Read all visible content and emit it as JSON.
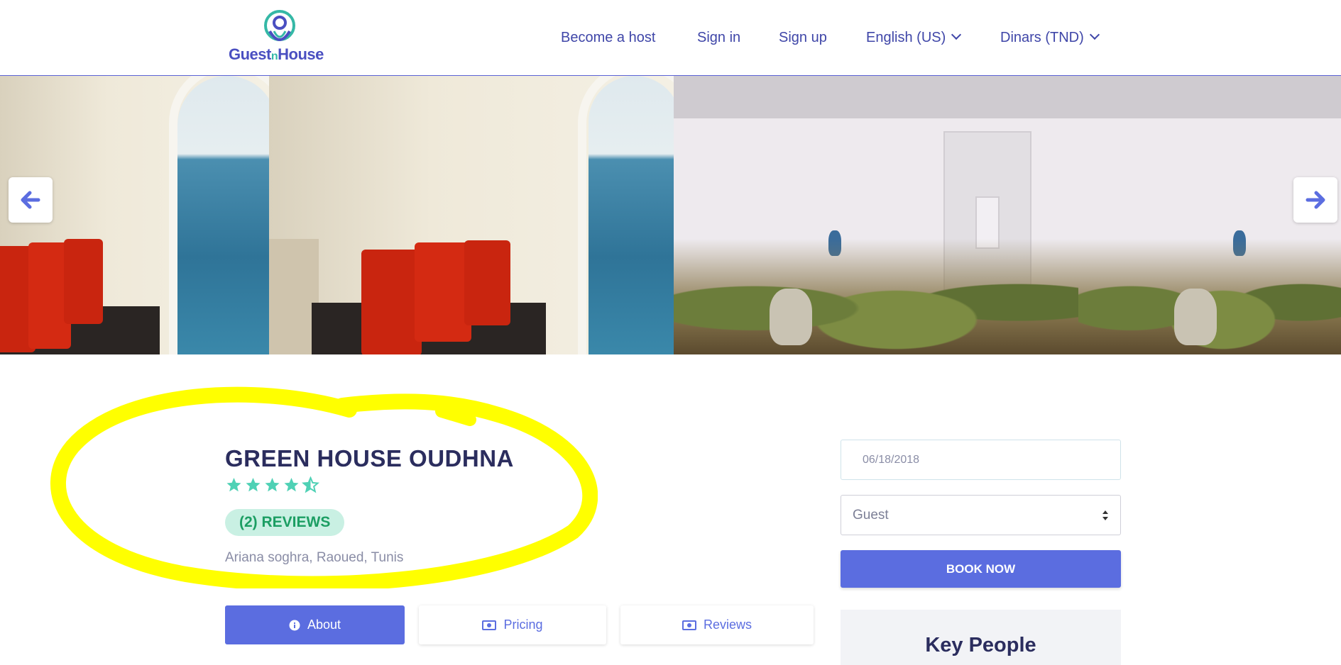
{
  "header": {
    "logo": {
      "text_main1": "Guest",
      "text_n": "n",
      "text_main2": "House"
    },
    "nav": {
      "become_host": "Become a host",
      "sign_in": "Sign in",
      "sign_up": "Sign up",
      "language": "English (US)",
      "currency": "Dinars (TND)"
    }
  },
  "gallery": {
    "prev_icon": "arrow-left-icon",
    "next_icon": "arrow-right-icon"
  },
  "listing": {
    "title": "GREEN HOUSE OUDHNA",
    "rating": 4.5,
    "rating_max": 5,
    "reviews_badge": "(2) REVIEWS",
    "location": "Ariana soghra, Raoued, Tunis"
  },
  "tabs": [
    {
      "label": "About",
      "icon": "info-circle-icon",
      "active": true
    },
    {
      "label": "Pricing",
      "icon": "money-bill-icon",
      "active": false
    },
    {
      "label": "Reviews",
      "icon": "money-bill-icon",
      "active": false
    }
  ],
  "booking": {
    "date_value": "06/18/2018",
    "guest_value": "Guest",
    "book_label": "BOOK NOW",
    "key_people_title": "Key People"
  },
  "colors": {
    "accent": "#5b6de0",
    "nav_text": "#3f46a8",
    "title": "#2b2d5e",
    "stars": "#4fd1b5",
    "badge_bg": "#c9f0e3",
    "badge_text": "#1c9e63",
    "highlight": "#ffff00"
  }
}
